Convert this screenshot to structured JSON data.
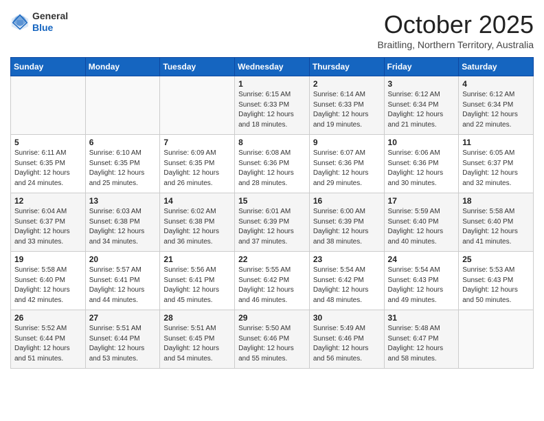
{
  "logo": {
    "general": "General",
    "blue": "Blue"
  },
  "header": {
    "month": "October 2025",
    "location": "Braitling, Northern Territory, Australia"
  },
  "weekdays": [
    "Sunday",
    "Monday",
    "Tuesday",
    "Wednesday",
    "Thursday",
    "Friday",
    "Saturday"
  ],
  "weeks": [
    [
      {
        "day": "",
        "sunrise": "",
        "sunset": "",
        "daylight": ""
      },
      {
        "day": "",
        "sunrise": "",
        "sunset": "",
        "daylight": ""
      },
      {
        "day": "",
        "sunrise": "",
        "sunset": "",
        "daylight": ""
      },
      {
        "day": "1",
        "sunrise": "Sunrise: 6:15 AM",
        "sunset": "Sunset: 6:33 PM",
        "daylight": "Daylight: 12 hours and 18 minutes."
      },
      {
        "day": "2",
        "sunrise": "Sunrise: 6:14 AM",
        "sunset": "Sunset: 6:33 PM",
        "daylight": "Daylight: 12 hours and 19 minutes."
      },
      {
        "day": "3",
        "sunrise": "Sunrise: 6:12 AM",
        "sunset": "Sunset: 6:34 PM",
        "daylight": "Daylight: 12 hours and 21 minutes."
      },
      {
        "day": "4",
        "sunrise": "Sunrise: 6:12 AM",
        "sunset": "Sunset: 6:34 PM",
        "daylight": "Daylight: 12 hours and 22 minutes."
      }
    ],
    [
      {
        "day": "5",
        "sunrise": "Sunrise: 6:11 AM",
        "sunset": "Sunset: 6:35 PM",
        "daylight": "Daylight: 12 hours and 24 minutes."
      },
      {
        "day": "6",
        "sunrise": "Sunrise: 6:10 AM",
        "sunset": "Sunset: 6:35 PM",
        "daylight": "Daylight: 12 hours and 25 minutes."
      },
      {
        "day": "7",
        "sunrise": "Sunrise: 6:09 AM",
        "sunset": "Sunset: 6:35 PM",
        "daylight": "Daylight: 12 hours and 26 minutes."
      },
      {
        "day": "8",
        "sunrise": "Sunrise: 6:08 AM",
        "sunset": "Sunset: 6:36 PM",
        "daylight": "Daylight: 12 hours and 28 minutes."
      },
      {
        "day": "9",
        "sunrise": "Sunrise: 6:07 AM",
        "sunset": "Sunset: 6:36 PM",
        "daylight": "Daylight: 12 hours and 29 minutes."
      },
      {
        "day": "10",
        "sunrise": "Sunrise: 6:06 AM",
        "sunset": "Sunset: 6:36 PM",
        "daylight": "Daylight: 12 hours and 30 minutes."
      },
      {
        "day": "11",
        "sunrise": "Sunrise: 6:05 AM",
        "sunset": "Sunset: 6:37 PM",
        "daylight": "Daylight: 12 hours and 32 minutes."
      }
    ],
    [
      {
        "day": "12",
        "sunrise": "Sunrise: 6:04 AM",
        "sunset": "Sunset: 6:37 PM",
        "daylight": "Daylight: 12 hours and 33 minutes."
      },
      {
        "day": "13",
        "sunrise": "Sunrise: 6:03 AM",
        "sunset": "Sunset: 6:38 PM",
        "daylight": "Daylight: 12 hours and 34 minutes."
      },
      {
        "day": "14",
        "sunrise": "Sunrise: 6:02 AM",
        "sunset": "Sunset: 6:38 PM",
        "daylight": "Daylight: 12 hours and 36 minutes."
      },
      {
        "day": "15",
        "sunrise": "Sunrise: 6:01 AM",
        "sunset": "Sunset: 6:39 PM",
        "daylight": "Daylight: 12 hours and 37 minutes."
      },
      {
        "day": "16",
        "sunrise": "Sunrise: 6:00 AM",
        "sunset": "Sunset: 6:39 PM",
        "daylight": "Daylight: 12 hours and 38 minutes."
      },
      {
        "day": "17",
        "sunrise": "Sunrise: 5:59 AM",
        "sunset": "Sunset: 6:40 PM",
        "daylight": "Daylight: 12 hours and 40 minutes."
      },
      {
        "day": "18",
        "sunrise": "Sunrise: 5:58 AM",
        "sunset": "Sunset: 6:40 PM",
        "daylight": "Daylight: 12 hours and 41 minutes."
      }
    ],
    [
      {
        "day": "19",
        "sunrise": "Sunrise: 5:58 AM",
        "sunset": "Sunset: 6:40 PM",
        "daylight": "Daylight: 12 hours and 42 minutes."
      },
      {
        "day": "20",
        "sunrise": "Sunrise: 5:57 AM",
        "sunset": "Sunset: 6:41 PM",
        "daylight": "Daylight: 12 hours and 44 minutes."
      },
      {
        "day": "21",
        "sunrise": "Sunrise: 5:56 AM",
        "sunset": "Sunset: 6:41 PM",
        "daylight": "Daylight: 12 hours and 45 minutes."
      },
      {
        "day": "22",
        "sunrise": "Sunrise: 5:55 AM",
        "sunset": "Sunset: 6:42 PM",
        "daylight": "Daylight: 12 hours and 46 minutes."
      },
      {
        "day": "23",
        "sunrise": "Sunrise: 5:54 AM",
        "sunset": "Sunset: 6:42 PM",
        "daylight": "Daylight: 12 hours and 48 minutes."
      },
      {
        "day": "24",
        "sunrise": "Sunrise: 5:54 AM",
        "sunset": "Sunset: 6:43 PM",
        "daylight": "Daylight: 12 hours and 49 minutes."
      },
      {
        "day": "25",
        "sunrise": "Sunrise: 5:53 AM",
        "sunset": "Sunset: 6:43 PM",
        "daylight": "Daylight: 12 hours and 50 minutes."
      }
    ],
    [
      {
        "day": "26",
        "sunrise": "Sunrise: 5:52 AM",
        "sunset": "Sunset: 6:44 PM",
        "daylight": "Daylight: 12 hours and 51 minutes."
      },
      {
        "day": "27",
        "sunrise": "Sunrise: 5:51 AM",
        "sunset": "Sunset: 6:44 PM",
        "daylight": "Daylight: 12 hours and 53 minutes."
      },
      {
        "day": "28",
        "sunrise": "Sunrise: 5:51 AM",
        "sunset": "Sunset: 6:45 PM",
        "daylight": "Daylight: 12 hours and 54 minutes."
      },
      {
        "day": "29",
        "sunrise": "Sunrise: 5:50 AM",
        "sunset": "Sunset: 6:46 PM",
        "daylight": "Daylight: 12 hours and 55 minutes."
      },
      {
        "day": "30",
        "sunrise": "Sunrise: 5:49 AM",
        "sunset": "Sunset: 6:46 PM",
        "daylight": "Daylight: 12 hours and 56 minutes."
      },
      {
        "day": "31",
        "sunrise": "Sunrise: 5:48 AM",
        "sunset": "Sunset: 6:47 PM",
        "daylight": "Daylight: 12 hours and 58 minutes."
      },
      {
        "day": "",
        "sunrise": "",
        "sunset": "",
        "daylight": ""
      }
    ]
  ]
}
